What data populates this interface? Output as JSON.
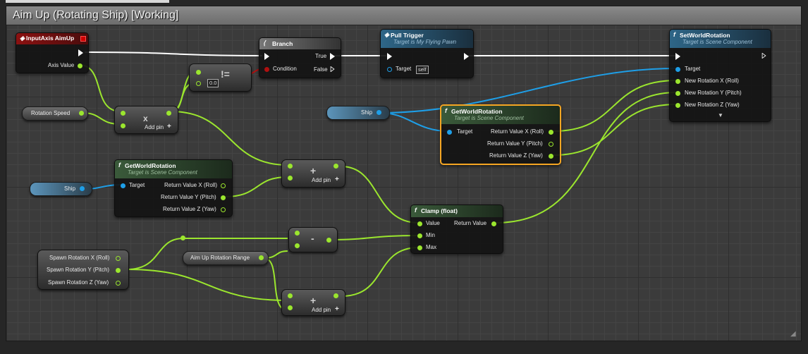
{
  "graph_title": "Aim Up (Rotating Ship) [Working]",
  "colors": {
    "exec": "#ffffff",
    "float": "#9be62e",
    "object": "#1e9fe8",
    "bool": "#b01010",
    "selection": "#f5a623"
  },
  "input_axis": {
    "title": "InputAxis AimUp",
    "pin": "Axis Value"
  },
  "branch": {
    "title": "Branch",
    "true_label": "True",
    "condition_label": "Condition",
    "false_label": "False"
  },
  "pull_trigger": {
    "title": "Pull Trigger",
    "subtitle": "Target is My Flying Pawn",
    "target_label": "Target",
    "target_value": "self"
  },
  "set_world_rotation": {
    "title": "SetWorldRotation",
    "subtitle": "Target is Scene Component",
    "pins": [
      "Target",
      "New Rotation X (Roll)",
      "New Rotation Y (Pitch)",
      "New Rotation Z (Yaw)"
    ]
  },
  "compare": {
    "symbol": "!=",
    "value": "0.0"
  },
  "rotation_speed": {
    "label": "Rotation Speed"
  },
  "multiply": {
    "symbol": "x",
    "add_pin": "Add pin"
  },
  "ship_var_1": {
    "label": "Ship"
  },
  "ship_var_2": {
    "label": "Ship"
  },
  "get_world_rotation_sel": {
    "title": "GetWorldRotation",
    "subtitle": "Target is Scene Component",
    "target_label": "Target",
    "outputs": [
      "Return Value X (Roll)",
      "Return Value Y (Pitch)",
      "Return Value Z (Yaw)"
    ]
  },
  "get_world_rotation_2": {
    "title": "GetWorldRotation",
    "subtitle": "Target is Scene Component",
    "target_label": "Target",
    "outputs": [
      "Return Value X (Roll)",
      "Return Value Y (Pitch)",
      "Return Value Z (Yaw)"
    ]
  },
  "add_1": {
    "symbol": "+",
    "add_pin": "Add pin"
  },
  "add_2": {
    "symbol": "+",
    "add_pin": "Add pin"
  },
  "subtract": {
    "symbol": "-"
  },
  "clamp": {
    "title": "Clamp (float)",
    "value_label": "Value",
    "return_label": "Return Value",
    "min_label": "Min",
    "max_label": "Max"
  },
  "spawn_rotation": {
    "outputs": [
      "Spawn Rotation X (Roll)",
      "Spawn Rotation Y (Pitch)",
      "Spawn Rotation Z (Yaw)"
    ]
  },
  "aim_up_range": {
    "label": "Aim Up Rotation Range"
  }
}
